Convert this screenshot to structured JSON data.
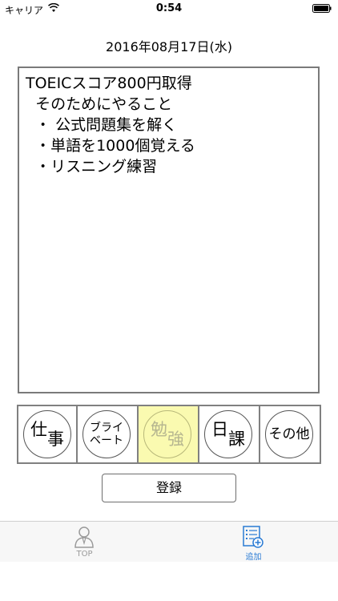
{
  "status_bar": {
    "carrier": "キャリア",
    "time": "0:54"
  },
  "date": "2016年08月17日(水)",
  "memo": {
    "text": "TOEICスコア800円取得\n  そのためにやること\n  ・ 公式問題集を解く\n  ・単語を1000個覚える\n  ・リスニング練習"
  },
  "categories": [
    {
      "top": "仕",
      "bottom": "事",
      "icon": "work-stamp"
    },
    {
      "top": "ブライ",
      "bottom": "ベート",
      "icon": "private-stamp"
    },
    {
      "top": "勉",
      "bottom": "強",
      "icon": "study-stamp",
      "selected": true
    },
    {
      "top": "日",
      "bottom": "課",
      "icon": "daily-task-stamp"
    },
    {
      "top": "その",
      "bottom": "他",
      "icon": "other-stamp"
    }
  ],
  "register_button": "登録",
  "tab_bar": {
    "tabs": [
      {
        "label": "TOP",
        "icon": "person-icon",
        "active": false
      },
      {
        "label": "追加",
        "icon": "add-list-icon",
        "active": true
      }
    ]
  },
  "colors": {
    "selected_category_bg": "#fafab0",
    "tab_active": "#2a7bd4",
    "tab_inactive": "#9a9a9a",
    "border": "#808080"
  }
}
